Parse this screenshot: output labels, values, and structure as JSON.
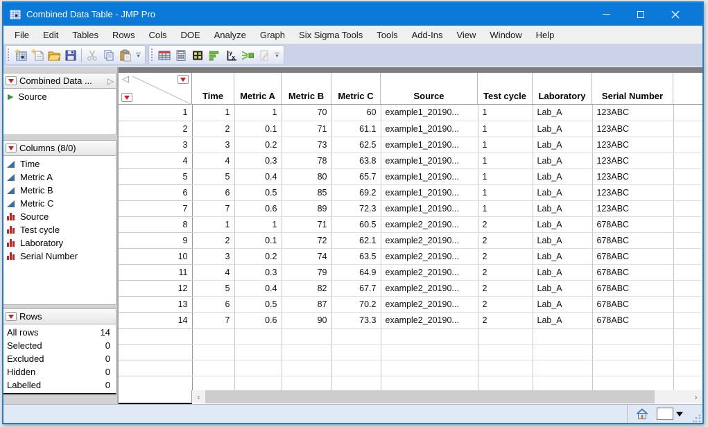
{
  "window": {
    "title": "Combined Data Table - JMP Pro"
  },
  "menu": {
    "items": [
      "File",
      "Edit",
      "Tables",
      "Rows",
      "Cols",
      "DOE",
      "Analyze",
      "Graph",
      "Six Sigma Tools",
      "Tools",
      "Add-Ins",
      "View",
      "Window",
      "Help"
    ]
  },
  "toolbar": {
    "groups": [
      {
        "icons": [
          "new-data-table-icon",
          "new-journal-icon",
          "open-icon",
          "save-icon",
          "separator",
          "cut-icon",
          "copy-icon",
          "paste-icon"
        ]
      },
      {
        "icons": [
          "data-table-window-icon",
          "formula-calculator-icon",
          "split-grid-icon",
          "graph-builder-icon",
          "fit-y-by-x-icon",
          "join-tables-icon",
          "script-editor-icon"
        ]
      }
    ]
  },
  "sidebar": {
    "table_panel": {
      "title": "Combined Data ...",
      "items": [
        {
          "label": "Source"
        }
      ]
    },
    "columns_panel": {
      "title": "Columns (8/0)",
      "items": [
        {
          "label": "Time",
          "type": "continuous"
        },
        {
          "label": "Metric A",
          "type": "continuous"
        },
        {
          "label": "Metric B",
          "type": "continuous"
        },
        {
          "label": "Metric C",
          "type": "continuous"
        },
        {
          "label": "Source",
          "type": "nominal"
        },
        {
          "label": "Test cycle",
          "type": "nominal"
        },
        {
          "label": "Laboratory",
          "type": "nominal"
        },
        {
          "label": "Serial Number",
          "type": "nominal"
        }
      ]
    },
    "rows_panel": {
      "title": "Rows",
      "stats": [
        {
          "label": "All rows",
          "value": "14"
        },
        {
          "label": "Selected",
          "value": "0"
        },
        {
          "label": "Excluded",
          "value": "0"
        },
        {
          "label": "Hidden",
          "value": "0"
        },
        {
          "label": "Labelled",
          "value": "0"
        }
      ]
    }
  },
  "table": {
    "columns": [
      "Time",
      "Metric A",
      "Metric B",
      "Metric C",
      "Source",
      "Test cycle",
      "Laboratory",
      "Serial Number"
    ],
    "rows": [
      [
        "1",
        "1",
        "1",
        "70",
        "60",
        "example1_20190...",
        "1",
        "Lab_A",
        "123ABC"
      ],
      [
        "2",
        "2",
        "0.1",
        "71",
        "61.1",
        "example1_20190...",
        "1",
        "Lab_A",
        "123ABC"
      ],
      [
        "3",
        "3",
        "0.2",
        "73",
        "62.5",
        "example1_20190...",
        "1",
        "Lab_A",
        "123ABC"
      ],
      [
        "4",
        "4",
        "0.3",
        "78",
        "63.8",
        "example1_20190...",
        "1",
        "Lab_A",
        "123ABC"
      ],
      [
        "5",
        "5",
        "0.4",
        "80",
        "65.7",
        "example1_20190...",
        "1",
        "Lab_A",
        "123ABC"
      ],
      [
        "6",
        "6",
        "0.5",
        "85",
        "69.2",
        "example1_20190...",
        "1",
        "Lab_A",
        "123ABC"
      ],
      [
        "7",
        "7",
        "0.6",
        "89",
        "72.3",
        "example1_20190...",
        "1",
        "Lab_A",
        "123ABC"
      ],
      [
        "8",
        "1",
        "1",
        "71",
        "60.5",
        "example2_20190...",
        "2",
        "Lab_A",
        "678ABC"
      ],
      [
        "9",
        "2",
        "0.1",
        "72",
        "62.1",
        "example2_20190...",
        "2",
        "Lab_A",
        "678ABC"
      ],
      [
        "10",
        "3",
        "0.2",
        "74",
        "63.5",
        "example2_20190...",
        "2",
        "Lab_A",
        "678ABC"
      ],
      [
        "11",
        "4",
        "0.3",
        "79",
        "64.9",
        "example2_20190...",
        "2",
        "Lab_A",
        "678ABC"
      ],
      [
        "12",
        "5",
        "0.4",
        "82",
        "67.7",
        "example2_20190...",
        "2",
        "Lab_A",
        "678ABC"
      ],
      [
        "13",
        "6",
        "0.5",
        "87",
        "70.2",
        "example2_20190...",
        "2",
        "Lab_A",
        "678ABC"
      ],
      [
        "14",
        "7",
        "0.6",
        "90",
        "73.3",
        "example2_20190...",
        "2",
        "Lab_A",
        "678ABC"
      ]
    ]
  },
  "colors": {
    "titlebar": "#0b79d7",
    "red_triangle": "#c41e1e",
    "continuous_icon": "#3a6ea5",
    "nominal_icon": "#cc2222",
    "toolbar_bg": "#ccd3e9"
  }
}
